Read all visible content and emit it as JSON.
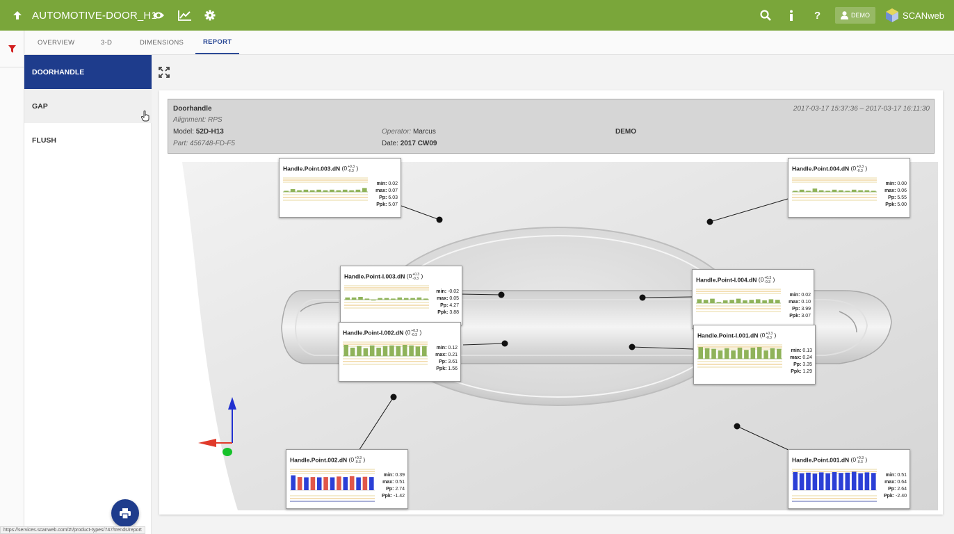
{
  "app": {
    "title": "AUTOMOTIVE-DOOR_H1",
    "brand": "SCANweb",
    "user": "DEMO",
    "accent_color": "#7aa63a",
    "nav_color": "#1e3c8c"
  },
  "tabs": [
    {
      "label": "OVERVIEW"
    },
    {
      "label": "3-D"
    },
    {
      "label": "DIMENSIONS"
    },
    {
      "label": "REPORT",
      "active": true
    }
  ],
  "sidebar": {
    "items": [
      {
        "label": "DOORHANDLE",
        "active": true
      },
      {
        "label": "GAP"
      },
      {
        "label": "FLUSH"
      }
    ]
  },
  "report": {
    "name": "Doorhandle",
    "alignment_label": "Alignment:",
    "alignment_value": "RPS",
    "model_label": "Model:",
    "model_value": "52D-H13",
    "part_label": "Part:",
    "part_value": "456748-FD-F5",
    "operator_label": "Operator:",
    "operator_value": "Marcus",
    "date_label": "Date:",
    "date_value": "2017 CW09",
    "customer": "DEMO",
    "time_range": "2017-03-17 15:37:36 – 2017-03-17 16:11:30"
  },
  "measurements": [
    {
      "title": "Handle.Point.003.dN",
      "nominal": "0",
      "tol_upper": "+0.3",
      "tol_lower": "-0.3",
      "min": "0.02",
      "max": "0.07",
      "pp": "6.03",
      "ppk": "5.07",
      "status": "ok",
      "bars": [
        0.02,
        0.05,
        0.03,
        0.04,
        0.03,
        0.04,
        0.03,
        0.04,
        0.03,
        0.04,
        0.03,
        0.04,
        0.07
      ]
    },
    {
      "title": "Handle.Point.004.dN",
      "nominal": "0",
      "tol_upper": "+0.3",
      "tol_lower": "-0.3",
      "min": "0.00",
      "max": "0.06",
      "pp": "5.55",
      "ppk": "5.00",
      "status": "ok",
      "bars": [
        0.02,
        0.04,
        0.02,
        0.06,
        0.03,
        0.02,
        0.04,
        0.03,
        0.02,
        0.04,
        0.03,
        0.03,
        0.02
      ]
    },
    {
      "title": "Handle.Point-I.003.dN",
      "nominal": "0",
      "tol_upper": "+0.3",
      "tol_lower": "-0.3",
      "min": "-0.02",
      "max": "0.05",
      "pp": "4.27",
      "ppk": "3.88",
      "status": "ok",
      "bars": [
        0.04,
        0.04,
        0.05,
        0.02,
        -0.01,
        0.03,
        0.03,
        0.02,
        0.04,
        0.03,
        0.03,
        0.04,
        0.02
      ]
    },
    {
      "title": "Handle.Point-I.004.dN",
      "nominal": "0",
      "tol_upper": "+0.3",
      "tol_lower": "-0.3",
      "min": "0.02",
      "max": "0.10",
      "pp": "3.99",
      "ppk": "3.07",
      "status": "ok",
      "bars": [
        0.07,
        0.06,
        0.08,
        0.02,
        0.05,
        0.06,
        0.08,
        0.05,
        0.06,
        0.07,
        0.05,
        0.07,
        0.06
      ]
    },
    {
      "title": "Handle.Point-I.002.dN",
      "nominal": "0",
      "tol_upper": "+0.3",
      "tol_lower": "-0.3",
      "min": "0.12",
      "max": "0.21",
      "pp": "3.61",
      "ppk": "1.56",
      "status": "ok",
      "bars": [
        0.2,
        0.15,
        0.18,
        0.14,
        0.19,
        0.15,
        0.18,
        0.19,
        0.18,
        0.2,
        0.19,
        0.17,
        0.18
      ]
    },
    {
      "title": "Handle.Point-I.001.dN",
      "nominal": "0",
      "tol_upper": "+0.3",
      "tol_lower": "-0.3",
      "min": "0.13",
      "max": "0.24",
      "pp": "3.35",
      "ppk": "1.29",
      "status": "ok",
      "bars": [
        0.21,
        0.19,
        0.18,
        0.15,
        0.19,
        0.15,
        0.2,
        0.16,
        0.2,
        0.21,
        0.15,
        0.19,
        0.18
      ]
    },
    {
      "title": "Handle.Point.002.dN",
      "nominal": "0",
      "tol_upper": "+0.3",
      "tol_lower": "-0.3",
      "min": "0.39",
      "max": "0.51",
      "pp": "2.74",
      "ppk": "-1.42",
      "status": "nok",
      "bars": [
        0.51,
        0.45,
        0.44,
        0.45,
        0.44,
        0.45,
        0.44,
        0.47,
        0.45,
        0.48,
        0.44,
        0.46,
        0.45
      ]
    },
    {
      "title": "Handle.Point.001.dN",
      "nominal": "0",
      "tol_upper": "+0.3",
      "tol_lower": "-0.3",
      "min": "0.51",
      "max": "0.64",
      "pp": "2.64",
      "ppk": "-2.40",
      "status": "nok",
      "bars": [
        0.62,
        0.58,
        0.6,
        0.57,
        0.61,
        0.58,
        0.62,
        0.59,
        0.6,
        0.63,
        0.58,
        0.61,
        0.59
      ]
    }
  ],
  "status_url": "https://services.scanweb.com/#!/product-types/747/trends/report"
}
